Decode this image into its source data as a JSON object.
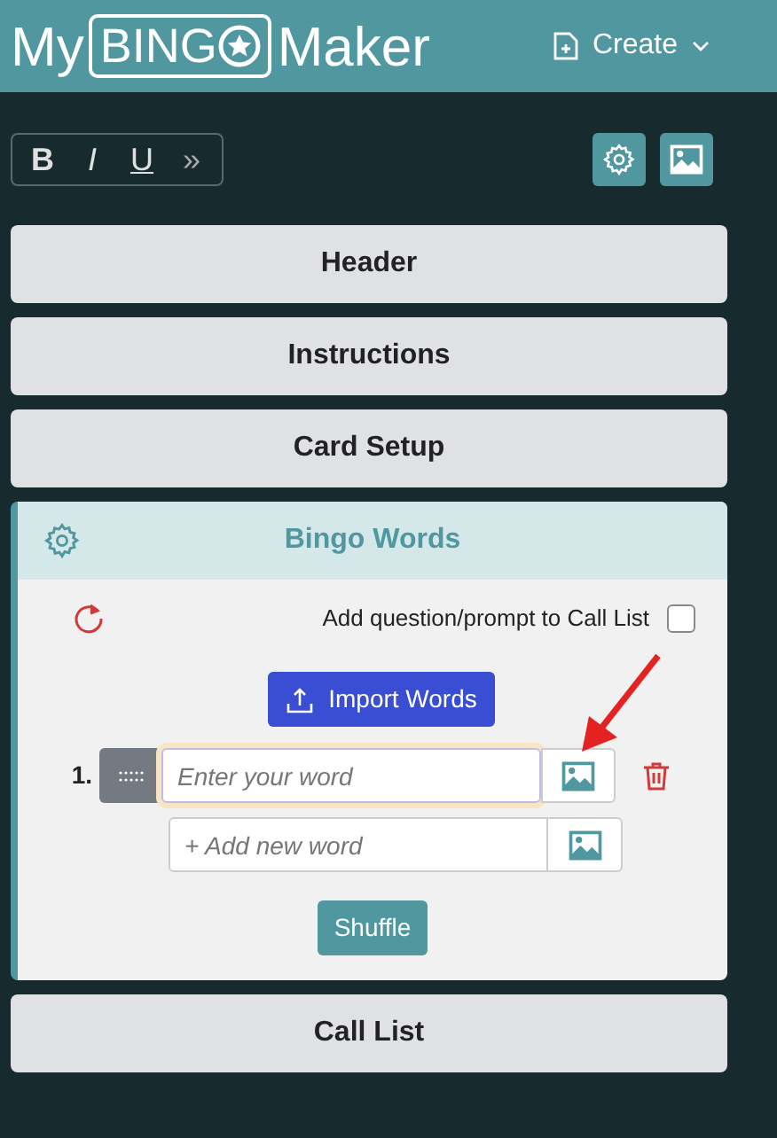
{
  "logo": {
    "before": "My",
    "boxed": "BING",
    "after": "Maker"
  },
  "create_menu": {
    "label": "Create"
  },
  "format_buttons": [
    "B",
    "I",
    "U",
    "»"
  ],
  "sections": [
    {
      "title": "Header",
      "expanded": false
    },
    {
      "title": "Instructions",
      "expanded": false
    },
    {
      "title": "Card Setup",
      "expanded": false
    },
    {
      "title": "Bingo Words",
      "expanded": true
    },
    {
      "title": "Call List",
      "expanded": false
    }
  ],
  "bingo_words": {
    "call_list_option": {
      "label": "Add question/prompt to Call List",
      "checked": false
    },
    "import_button": "Import Words",
    "words": [
      {
        "number": "1.",
        "placeholder": "Enter your word",
        "focused": true
      }
    ],
    "new_word": {
      "placeholder": "+ Add new word"
    },
    "shuffle_button": "Shuffle"
  }
}
